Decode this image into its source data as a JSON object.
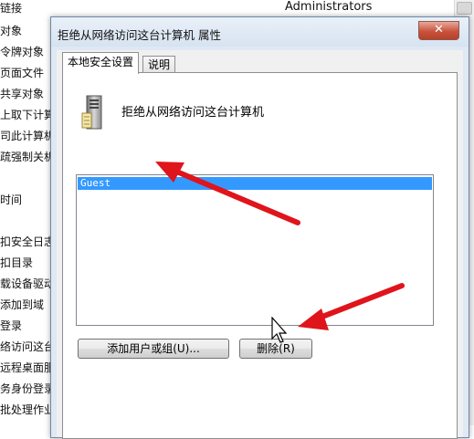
{
  "background": {
    "column_header": "Administrators",
    "policy_items": [
      "链接",
      "对象",
      "令牌对象",
      "页面文件",
      "共享对象",
      "上取下计算",
      "司此计算机",
      "疏强制关机",
      "时间",
      "扣安全日志",
      "扣目录",
      "载设备驱动",
      "添加到域",
      "登录",
      "络访问这台",
      "远程桌面服",
      "务身份登录",
      "批处理作业"
    ]
  },
  "dialog": {
    "title": "拒绝从网络访问这台计算机 属性",
    "close_symbol": "✕",
    "tabs": [
      {
        "label": "本地安全设置",
        "active": true
      },
      {
        "label": "说明",
        "active": false
      }
    ],
    "policy_heading": "拒绝从网络访问这台计算机",
    "list_items": [
      {
        "label": "Guest",
        "selected": true
      }
    ],
    "buttons": {
      "add_label": "添加用户或组(U)...",
      "remove_label": "删除(R)"
    }
  },
  "colors": {
    "selection": "#3399ff",
    "annotation_arrow": "#e0141b",
    "close_button": "#c8533d"
  },
  "icons": {
    "policy": "server-policy-icon",
    "close": "close-icon",
    "cursor": "mouse-pointer-icon"
  }
}
